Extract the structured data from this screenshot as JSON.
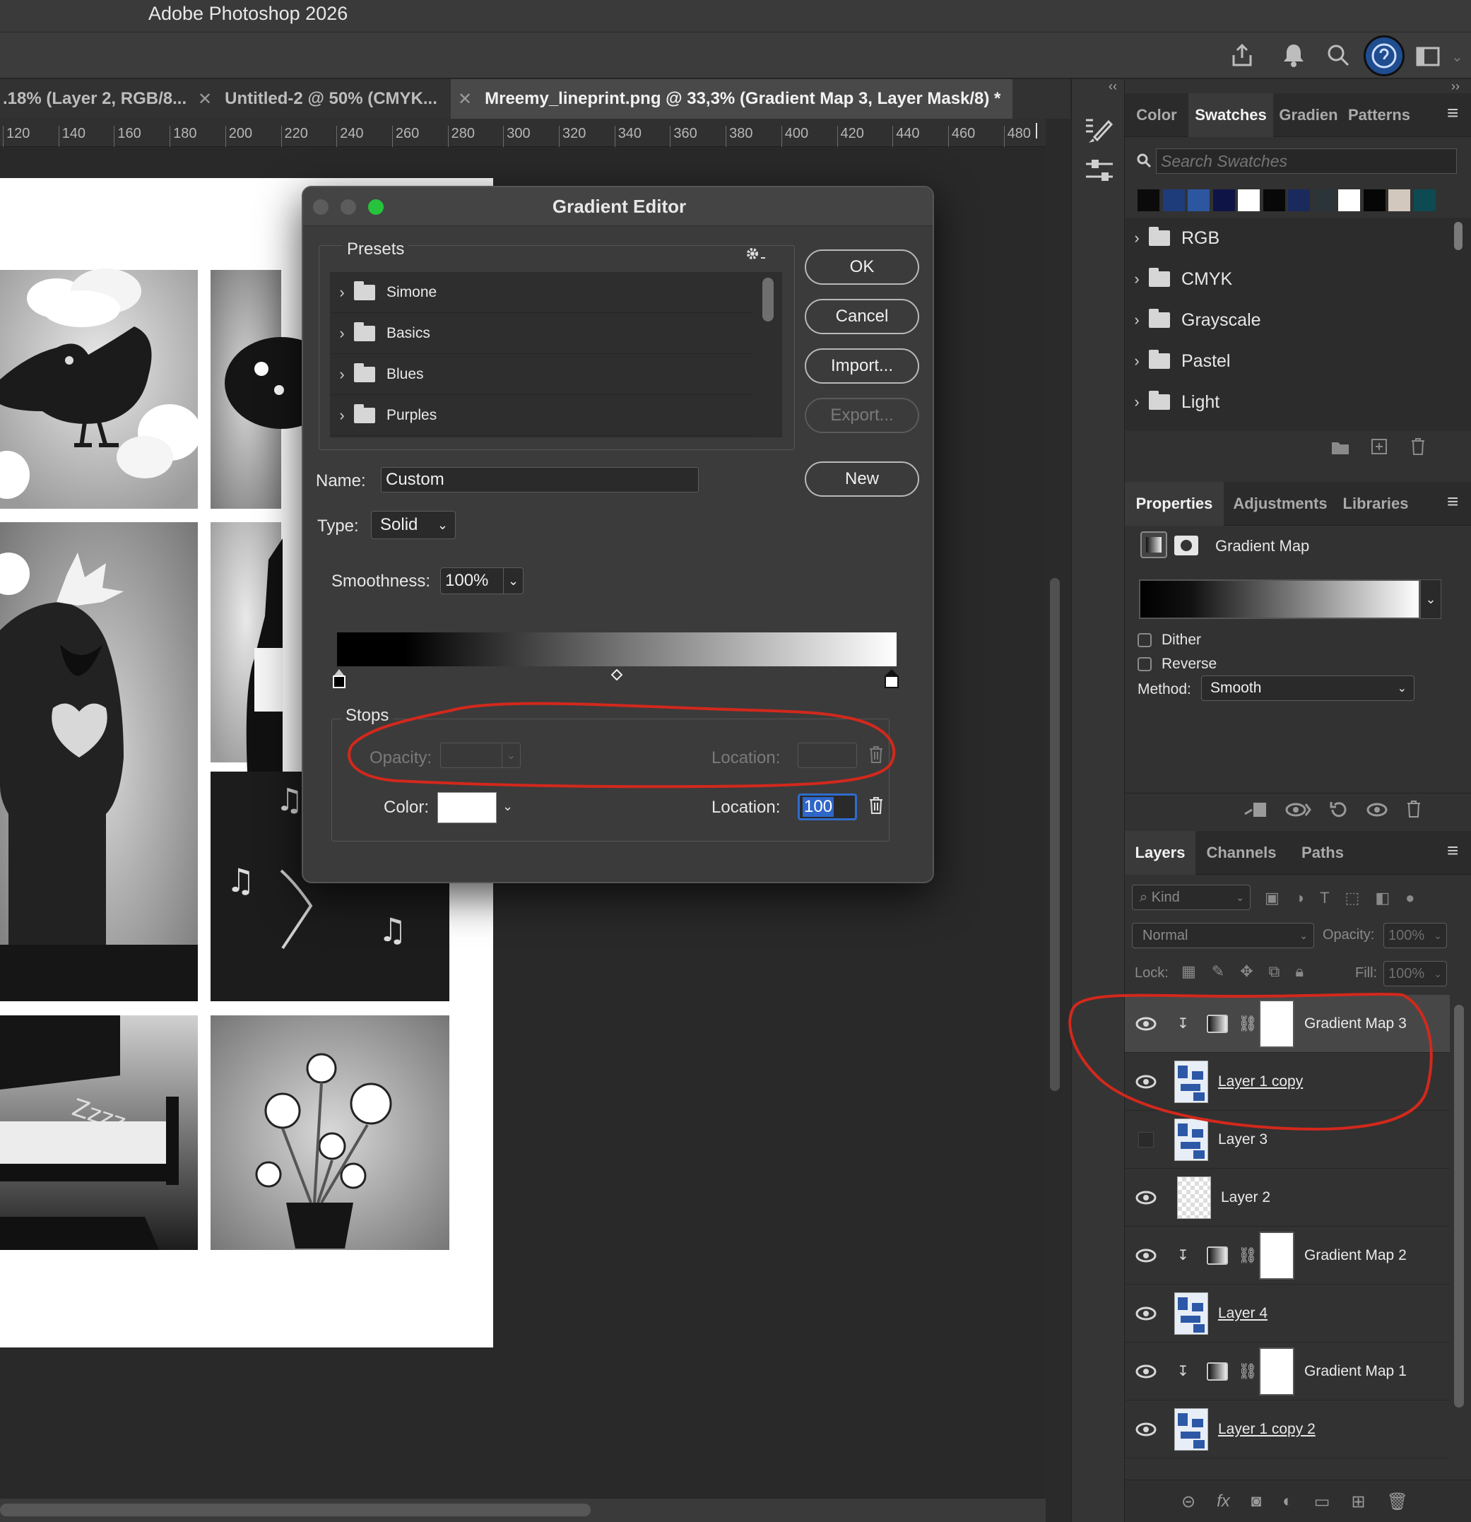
{
  "app": {
    "title": "Adobe Photoshop 2026"
  },
  "doc_tabs": [
    {
      "label": ".18% (Layer 2, RGB/8...",
      "active": false
    },
    {
      "label": "Untitled-2 @ 50% (CMYK...",
      "active": false
    },
    {
      "label": "Mreemy_lineprint.png @ 33,3% (Gradient Map 3, Layer Mask/8) *",
      "active": true
    }
  ],
  "ruler": [
    "120",
    "140",
    "160",
    "180",
    "200",
    "220",
    "240",
    "260",
    "280",
    "300",
    "320",
    "340",
    "360",
    "380",
    "400",
    "420",
    "440",
    "460",
    "480"
  ],
  "dialog": {
    "title": "Gradient Editor",
    "presets_label": "Presets",
    "preset_folders": [
      "Simone",
      "Basics",
      "Blues",
      "Purples"
    ],
    "buttons": {
      "ok": "OK",
      "cancel": "Cancel",
      "import": "Import...",
      "export": "Export...",
      "new": "New"
    },
    "name_label": "Name:",
    "name_value": "Custom",
    "type_label": "Type:",
    "type_value": "Solid",
    "smoothness_label": "Smoothness:",
    "smoothness_value": "100%",
    "stops_label": "Stops",
    "opacity_label": "Opacity:",
    "location_label": "Location:",
    "color_label": "Color:",
    "color_location_value": "100"
  },
  "swatches_panel": {
    "tabs": [
      "Color",
      "Swatches",
      "Gradien",
      "Patterns"
    ],
    "active_tab": "Swatches",
    "search_placeholder": "Search Swatches",
    "colors": [
      "#0b0b0b",
      "#1f3c7a",
      "#2c56a0",
      "#0f1446",
      "#ffffff",
      "#080808",
      "#1b2a5c",
      "#2a3439",
      "#ffffff",
      "#060606",
      "#d2c8bd",
      "#0e4a52"
    ],
    "groups": [
      "RGB",
      "CMYK",
      "Grayscale",
      "Pastel",
      "Light"
    ]
  },
  "properties_panel": {
    "tabs": [
      "Properties",
      "Adjustments",
      "Libraries"
    ],
    "active_tab": "Properties",
    "title": "Gradient Map",
    "dither_label": "Dither",
    "reverse_label": "Reverse",
    "method_label": "Method:",
    "method_value": "Smooth"
  },
  "layers_panel": {
    "tabs": [
      "Layers",
      "Channels",
      "Paths"
    ],
    "active_tab": "Layers",
    "kind_placeholder": "Kind",
    "blend_mode": "Normal",
    "opacity_label": "Opacity:",
    "opacity_value": "100%",
    "lock_label": "Lock:",
    "fill_label": "Fill:",
    "fill_value": "100%",
    "layers": [
      {
        "name": "Gradient Map 3",
        "kind": "adjustment",
        "visible": true,
        "underline": false
      },
      {
        "name": "Layer 1 copy",
        "kind": "pixel",
        "visible": true,
        "underline": true
      },
      {
        "name": "Layer 3",
        "kind": "pixel",
        "visible": false,
        "underline": false
      },
      {
        "name": "Layer 2",
        "kind": "pixel-transparent",
        "visible": true,
        "underline": false
      },
      {
        "name": "Gradient Map 2",
        "kind": "adjustment",
        "visible": true,
        "underline": false
      },
      {
        "name": "Layer 4",
        "kind": "pixel",
        "visible": true,
        "underline": true
      },
      {
        "name": "Gradient Map 1",
        "kind": "adjustment",
        "visible": true,
        "underline": false
      },
      {
        "name": "Layer 1 copy 2",
        "kind": "pixel",
        "visible": true,
        "underline": true
      }
    ]
  },
  "annotation_color": "#d3281c"
}
